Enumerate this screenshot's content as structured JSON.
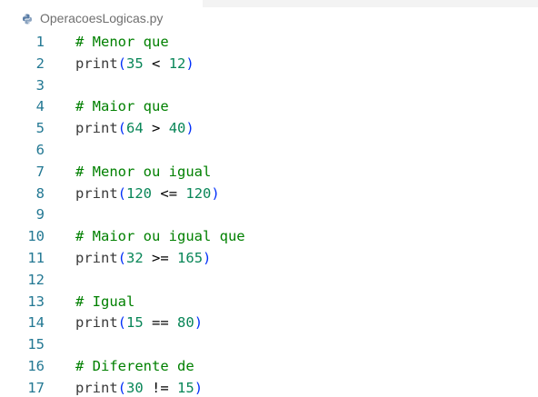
{
  "tab": {
    "filename": "OperacoesLogicas.py",
    "icon": "python-icon"
  },
  "colors": {
    "comment": "#008000",
    "number": "#098658",
    "bracket": "#0431fa",
    "line_number": "#237893",
    "identifier": "#3a3a3a"
  },
  "lines": [
    {
      "n": "1",
      "comment": "# Menor que"
    },
    {
      "n": "2",
      "fn": "print",
      "a": "35",
      "op": "<",
      "b": "12"
    },
    {
      "n": "3"
    },
    {
      "n": "4",
      "comment": "# Maior que"
    },
    {
      "n": "5",
      "fn": "print",
      "a": "64",
      "op": ">",
      "b": "40"
    },
    {
      "n": "6"
    },
    {
      "n": "7",
      "comment": "# Menor ou igual"
    },
    {
      "n": "8",
      "fn": "print",
      "a": "120",
      "op": "<=",
      "b": "120"
    },
    {
      "n": "9"
    },
    {
      "n": "10",
      "comment": "# Maior ou igual que"
    },
    {
      "n": "11",
      "fn": "print",
      "a": "32",
      "op": ">=",
      "b": "165"
    },
    {
      "n": "12"
    },
    {
      "n": "13",
      "comment": "# Igual"
    },
    {
      "n": "14",
      "fn": "print",
      "a": "15",
      "op": "==",
      "b": "80"
    },
    {
      "n": "15"
    },
    {
      "n": "16",
      "comment": "# Diferente de"
    },
    {
      "n": "17",
      "fn": "print",
      "a": "30",
      "op": "!=",
      "b": "15"
    }
  ]
}
